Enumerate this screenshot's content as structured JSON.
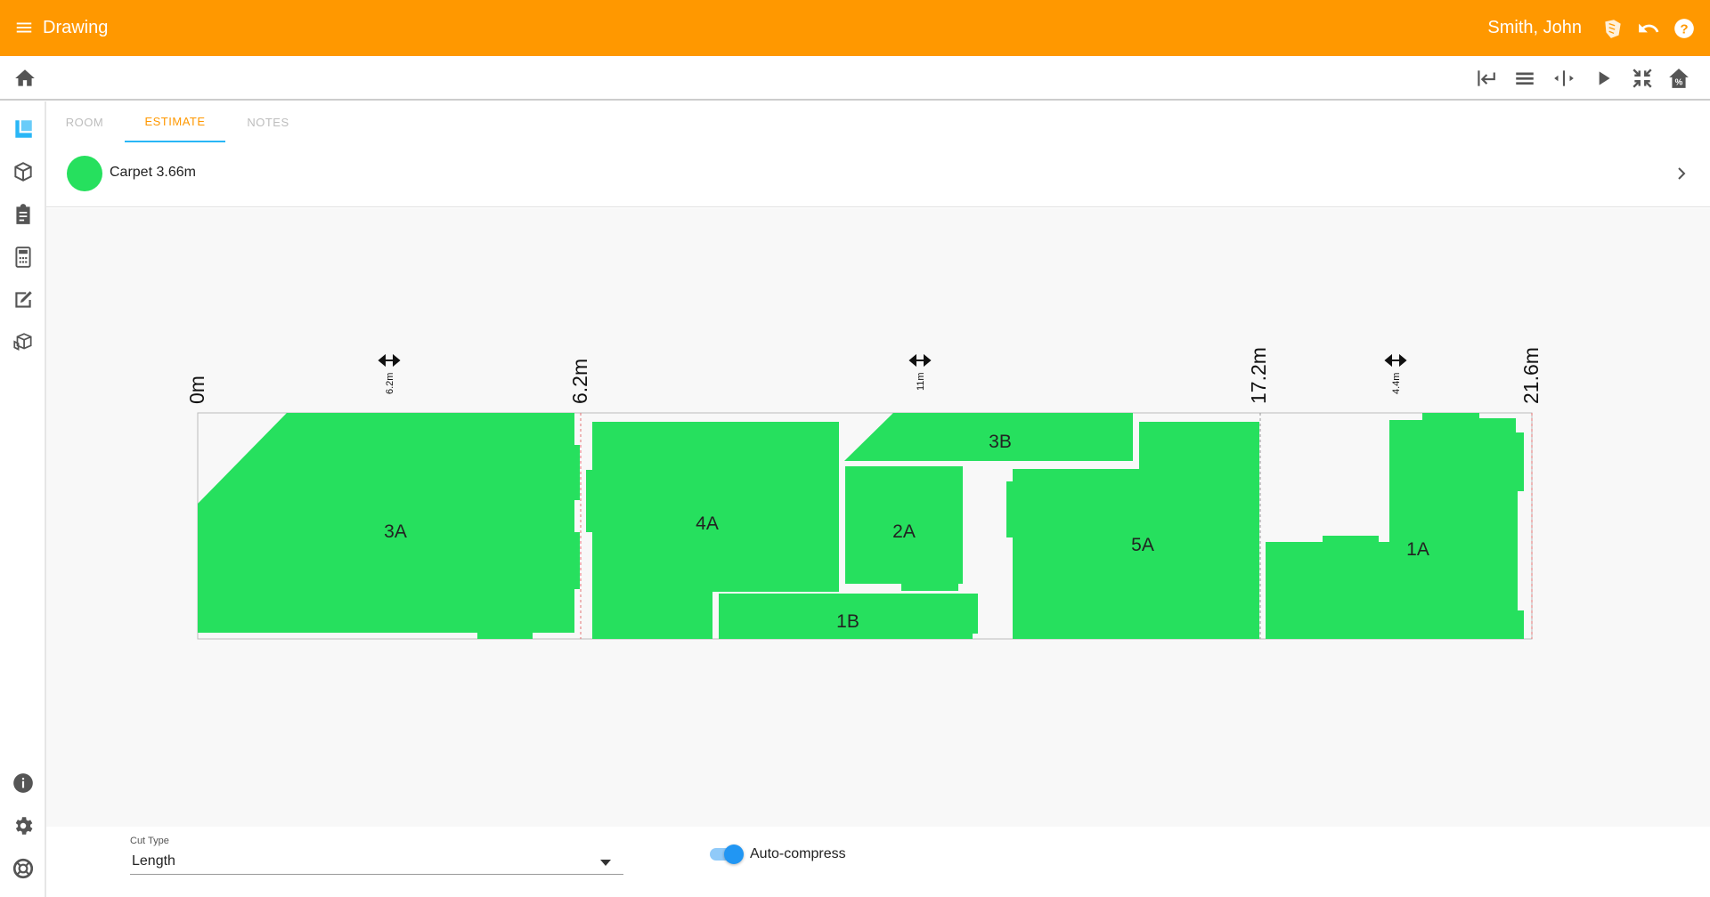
{
  "appbar": {
    "title": "Drawing",
    "user": "Smith, John",
    "icons": [
      "menu-icon",
      "brand-icon",
      "undo-icon",
      "help-icon"
    ]
  },
  "toolbar": {
    "icons": [
      "home-icon",
      "align-wall-icon",
      "list-icon",
      "split-icon",
      "play-icon",
      "compress-icon",
      "house-percent-icon"
    ]
  },
  "sidebar": {
    "icons": [
      "floor-icon",
      "box-icon",
      "clipboard-icon",
      "calculator-icon",
      "edit-icon",
      "boxes-icon",
      "info-icon",
      "settings-icon",
      "support-icon"
    ]
  },
  "tabs": [
    {
      "label": "ROOM",
      "active": false
    },
    {
      "label": "ESTIMATE",
      "active": true
    },
    {
      "label": "NOTES",
      "active": false
    }
  ],
  "material": {
    "label": "Carpet 3.66m",
    "color": "#26e05e"
  },
  "cut_layout": {
    "markers": [
      "0m",
      "6.2m",
      "17.2m",
      "21.6m"
    ],
    "spans": [
      "6.2m",
      "11m",
      "4.4m"
    ],
    "pieces": [
      "3A",
      "4A",
      "3B",
      "2A",
      "1B",
      "5A",
      "1A"
    ]
  },
  "bottom": {
    "cut_type_label": "Cut Type",
    "cut_type_value": "Length",
    "auto_compress_label": "Auto-compress",
    "auto_compress_on": true
  },
  "colors": {
    "accent": "#ff9800",
    "piece": "#26e05e",
    "active_tab_underline": "#29b6f6",
    "sidebar_active": "#29b6f6"
  }
}
